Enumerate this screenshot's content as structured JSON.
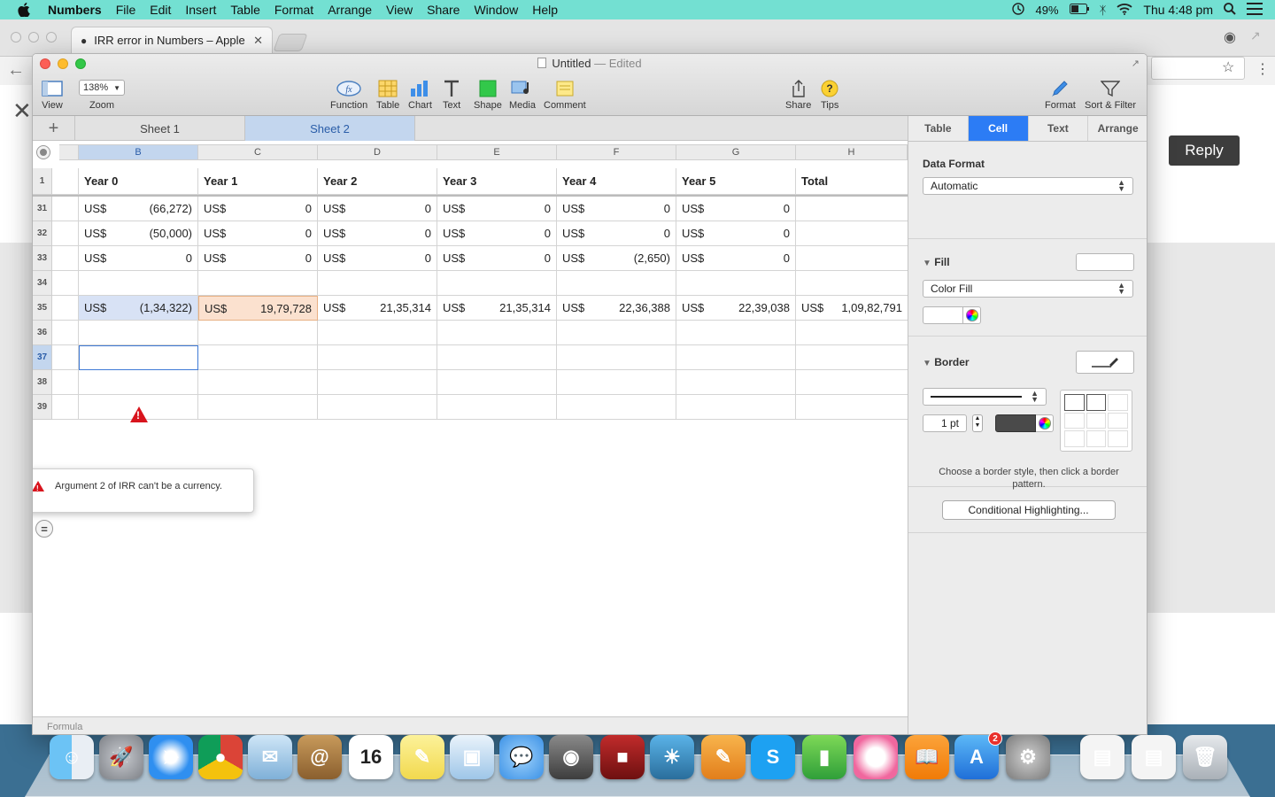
{
  "menubar": {
    "app_name": "Numbers",
    "items": [
      "File",
      "Edit",
      "Insert",
      "Table",
      "Format",
      "Arrange",
      "View",
      "Share",
      "Window",
      "Help"
    ],
    "battery": "49%",
    "clock": "Thu 4:48 pm"
  },
  "browser": {
    "tab_title": "IRR error in Numbers – Apple",
    "reply_label": "Reply"
  },
  "window": {
    "doc_name": "Untitled",
    "doc_status": "— Edited"
  },
  "toolbar": {
    "view": "View",
    "zoom_value": "138%",
    "zoom": "Zoom",
    "function": "Function",
    "table": "Table",
    "chart": "Chart",
    "text": "Text",
    "shape": "Shape",
    "media": "Media",
    "comment": "Comment",
    "share": "Share",
    "tips": "Tips",
    "format": "Format",
    "sort_filter": "Sort & Filter"
  },
  "sheets": [
    "Sheet 1",
    "Sheet 2"
  ],
  "grid": {
    "columns": [
      "B",
      "C",
      "D",
      "E",
      "F",
      "G",
      "H"
    ],
    "header_row_num": "1",
    "headers": [
      "Year 0",
      "Year 1",
      "Year 2",
      "Year 3",
      "Year 4",
      "Year 5",
      "Total"
    ],
    "rows": [
      {
        "num": "31",
        "cells": [
          [
            "US$",
            "(66,272)"
          ],
          [
            "US$",
            "0"
          ],
          [
            "US$",
            "0"
          ],
          [
            "US$",
            "0"
          ],
          [
            "US$",
            "0"
          ],
          [
            "US$",
            "0"
          ],
          [
            "",
            ""
          ]
        ]
      },
      {
        "num": "32",
        "cells": [
          [
            "US$",
            "(50,000)"
          ],
          [
            "US$",
            "0"
          ],
          [
            "US$",
            "0"
          ],
          [
            "US$",
            "0"
          ],
          [
            "US$",
            "0"
          ],
          [
            "US$",
            "0"
          ],
          [
            "",
            ""
          ]
        ]
      },
      {
        "num": "33",
        "cells": [
          [
            "US$",
            "0"
          ],
          [
            "US$",
            "0"
          ],
          [
            "US$",
            "0"
          ],
          [
            "US$",
            "0"
          ],
          [
            "US$",
            "(2,650)"
          ],
          [
            "US$",
            "0"
          ],
          [
            "",
            ""
          ]
        ]
      },
      {
        "num": "34",
        "cells": [
          [
            "",
            ""
          ],
          [
            "",
            ""
          ],
          [
            "",
            ""
          ],
          [
            "",
            ""
          ],
          [
            "",
            ""
          ],
          [
            "",
            ""
          ],
          [
            "",
            ""
          ]
        ]
      },
      {
        "num": "35",
        "cells": [
          [
            "US$",
            "(1,34,322)"
          ],
          [
            "US$",
            "19,79,728"
          ],
          [
            "US$",
            "21,35,314"
          ],
          [
            "US$",
            "21,35,314"
          ],
          [
            "US$",
            "22,36,388"
          ],
          [
            "US$",
            "22,39,038"
          ],
          [
            "US$",
            "1,09,82,791"
          ]
        ]
      },
      {
        "num": "36",
        "cells": [
          [
            "",
            ""
          ],
          [
            "",
            ""
          ],
          [
            "",
            ""
          ],
          [
            "",
            ""
          ],
          [
            "",
            ""
          ],
          [
            "",
            ""
          ],
          [
            "",
            ""
          ]
        ]
      },
      {
        "num": "37",
        "cells": [
          [
            "",
            ""
          ],
          [
            "",
            ""
          ],
          [
            "",
            ""
          ],
          [
            "",
            ""
          ],
          [
            "",
            ""
          ],
          [
            "",
            ""
          ],
          [
            "",
            ""
          ]
        ]
      },
      {
        "num": "38",
        "cells": [
          [
            "",
            ""
          ],
          [
            "",
            ""
          ],
          [
            "",
            ""
          ],
          [
            "",
            ""
          ],
          [
            "",
            ""
          ],
          [
            "",
            ""
          ],
          [
            "",
            ""
          ]
        ]
      },
      {
        "num": "39",
        "cells": [
          [
            "",
            ""
          ],
          [
            "",
            ""
          ],
          [
            "",
            ""
          ],
          [
            "",
            ""
          ],
          [
            "",
            ""
          ],
          [
            "",
            ""
          ],
          [
            "",
            ""
          ]
        ]
      }
    ],
    "error_message": "Argument 2 of IRR can't be a currency.",
    "formula_bar": "Formula"
  },
  "inspector": {
    "tabs": [
      "Table",
      "Cell",
      "Text",
      "Arrange"
    ],
    "active_tab": "Cell",
    "data_format_label": "Data Format",
    "data_format_value": "Automatic",
    "fill_label": "Fill",
    "fill_type": "Color Fill",
    "border_label": "Border",
    "border_width": "1 pt",
    "border_hint": "Choose a border style, then click a border pattern.",
    "conditional_button": "Conditional Highlighting..."
  },
  "dock": {
    "apps": [
      "Finder",
      "Launchpad",
      "Safari",
      "Chrome",
      "Mail",
      "Contacts",
      "Calendar",
      "Notes",
      "Preview",
      "Messages",
      "FaceTime",
      "Photo Booth",
      "iPhoto",
      "Pages",
      "Skype",
      "Numbers",
      "iTunes",
      "iBooks",
      "App Store",
      "System Preferences",
      "Documents",
      "Documents",
      "Trash"
    ],
    "calendar_day": "16",
    "appstore_badge": "2"
  },
  "colors": {
    "menubar": "#73e0d2",
    "accent": "#2c7cf5",
    "error_red": "#d8141d",
    "selected_col": "#c3d6ee",
    "highlight_orange": "#fbe1cf"
  }
}
